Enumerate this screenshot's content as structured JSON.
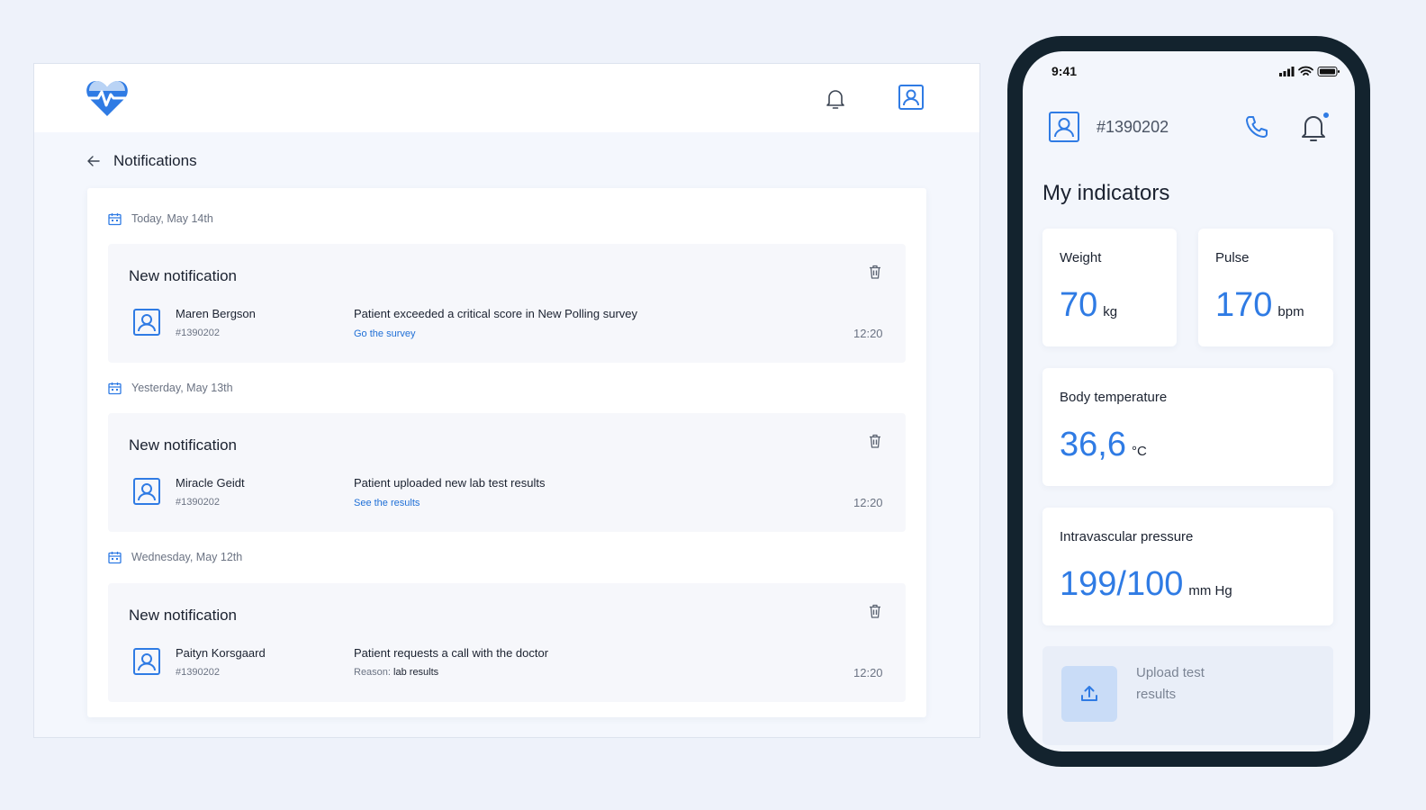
{
  "desktop": {
    "header": {
      "logo_icon": "heart-pulse-icon",
      "bell_icon": "bell-icon",
      "profile_icon": "user-square-icon"
    },
    "page_title": "Notifications",
    "groups": [
      {
        "date": "Today, May 14th",
        "card": {
          "title": "New notification",
          "name": "Maren Bergson",
          "id": "#1390202",
          "message": "Patient exceeded a critical score in New Polling survey",
          "link": "Go the survey",
          "time": "12:20"
        }
      },
      {
        "date": "Yesterday, May 13th",
        "card": {
          "title": "New notification",
          "name": "Miracle Geidt",
          "id": "#1390202",
          "message": "Patient uploaded new lab test results",
          "link": "See the results",
          "time": "12:20"
        }
      },
      {
        "date": "Wednesday, May 12th",
        "card": {
          "title": "New notification",
          "name": "Paityn Korsgaard",
          "id": "#1390202",
          "message": "Patient requests a call with the doctor",
          "reason_label": "Reason:",
          "reason_value": " lab results",
          "time": "12:20"
        }
      }
    ]
  },
  "phone": {
    "status_time": "9:41",
    "patient_id": "#1390202",
    "title": "My indicators",
    "tiles": {
      "weight": {
        "label": "Weight",
        "value": "70",
        "unit": "kg"
      },
      "pulse": {
        "label": "Pulse",
        "value": "170",
        "unit": "bpm"
      },
      "temperature": {
        "label": "Body temperature",
        "value": "36,6",
        "unit": "°C"
      },
      "pressure": {
        "label": "Intravascular pressure",
        "value": "199/100",
        "unit": "mm Hg"
      }
    },
    "upload_label": "Upload test results"
  },
  "colors": {
    "accent": "#2f7be4",
    "link": "#1f6fd6",
    "phone_frame": "#13232e",
    "background": "#eef2fa"
  }
}
